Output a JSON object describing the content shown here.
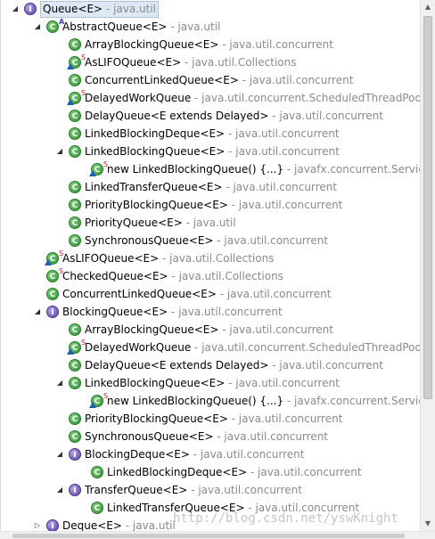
{
  "tree": [
    {
      "indent": 0,
      "twisty": "open",
      "icon": "iface",
      "overlay": "",
      "name": "Queue<E>",
      "pkg": " - java.util",
      "selected": true
    },
    {
      "indent": 1,
      "twisty": "open",
      "icon": "class",
      "overlay": "A",
      "name": "AbstractQueue<E>",
      "pkg": " - java.util"
    },
    {
      "indent": 2,
      "twisty": "",
      "icon": "class",
      "overlay": "",
      "name": "ArrayBlockingQueue<E>",
      "pkg": " - java.util.concurrent"
    },
    {
      "indent": 2,
      "twisty": "",
      "icon": "class",
      "overlay": "S",
      "tri": true,
      "name": "AsLIFOQueue<E>",
      "pkg": " - java.util.Collections"
    },
    {
      "indent": 2,
      "twisty": "",
      "icon": "class",
      "overlay": "",
      "name": "ConcurrentLinkedQueue<E>",
      "pkg": " - java.util.concurrent"
    },
    {
      "indent": 2,
      "twisty": "",
      "icon": "class",
      "overlay": "S",
      "tri": true,
      "name": "DelayedWorkQueue",
      "pkg": " - java.util.concurrent.ScheduledThreadPoo"
    },
    {
      "indent": 2,
      "twisty": "",
      "icon": "class",
      "overlay": "",
      "name": "DelayQueue<E extends Delayed>",
      "pkg": " - java.util.concurrent"
    },
    {
      "indent": 2,
      "twisty": "",
      "icon": "class",
      "overlay": "",
      "name": "LinkedBlockingDeque<E>",
      "pkg": " - java.util.concurrent"
    },
    {
      "indent": 2,
      "twisty": "open",
      "icon": "class",
      "overlay": "",
      "name": "LinkedBlockingQueue<E>",
      "pkg": " - java.util.concurrent"
    },
    {
      "indent": 3,
      "twisty": "",
      "icon": "class",
      "overlay": "S",
      "tri": true,
      "name": "new LinkedBlockingQueue() {...}",
      "pkg": " - javafx.concurrent.Service"
    },
    {
      "indent": 2,
      "twisty": "",
      "icon": "class",
      "overlay": "",
      "name": "LinkedTransferQueue<E>",
      "pkg": " - java.util.concurrent"
    },
    {
      "indent": 2,
      "twisty": "",
      "icon": "class",
      "overlay": "",
      "name": "PriorityBlockingQueue<E>",
      "pkg": " - java.util.concurrent"
    },
    {
      "indent": 2,
      "twisty": "",
      "icon": "class",
      "overlay": "",
      "name": "PriorityQueue<E>",
      "pkg": " - java.util"
    },
    {
      "indent": 2,
      "twisty": "",
      "icon": "class",
      "overlay": "",
      "name": "SynchronousQueue<E>",
      "pkg": " - java.util.concurrent"
    },
    {
      "indent": 1,
      "twisty": "",
      "icon": "class",
      "overlay": "S",
      "tri": true,
      "name": "AsLIFOQueue<E>",
      "pkg": " - java.util.Collections"
    },
    {
      "indent": 1,
      "twisty": "",
      "icon": "class",
      "overlay": "S",
      "name": "CheckedQueue<E>",
      "pkg": " - java.util.Collections"
    },
    {
      "indent": 1,
      "twisty": "",
      "icon": "class",
      "overlay": "",
      "name": "ConcurrentLinkedQueue<E>",
      "pkg": " - java.util.concurrent"
    },
    {
      "indent": 1,
      "twisty": "open",
      "icon": "iface",
      "overlay": "",
      "name": "BlockingQueue<E>",
      "pkg": " - java.util.concurrent"
    },
    {
      "indent": 2,
      "twisty": "",
      "icon": "class",
      "overlay": "",
      "name": "ArrayBlockingQueue<E>",
      "pkg": " - java.util.concurrent"
    },
    {
      "indent": 2,
      "twisty": "",
      "icon": "class",
      "overlay": "S",
      "tri": true,
      "name": "DelayedWorkQueue",
      "pkg": " - java.util.concurrent.ScheduledThreadPoo"
    },
    {
      "indent": 2,
      "twisty": "",
      "icon": "class",
      "overlay": "",
      "name": "DelayQueue<E extends Delayed>",
      "pkg": " - java.util.concurrent"
    },
    {
      "indent": 2,
      "twisty": "open",
      "icon": "class",
      "overlay": "",
      "name": "LinkedBlockingQueue<E>",
      "pkg": " - java.util.concurrent"
    },
    {
      "indent": 3,
      "twisty": "",
      "icon": "class",
      "overlay": "S",
      "tri": true,
      "name": "new LinkedBlockingQueue() {...}",
      "pkg": " - javafx.concurrent.Service"
    },
    {
      "indent": 2,
      "twisty": "",
      "icon": "class",
      "overlay": "",
      "name": "PriorityBlockingQueue<E>",
      "pkg": " - java.util.concurrent"
    },
    {
      "indent": 2,
      "twisty": "",
      "icon": "class",
      "overlay": "",
      "name": "SynchronousQueue<E>",
      "pkg": " - java.util.concurrent"
    },
    {
      "indent": 2,
      "twisty": "open",
      "icon": "iface",
      "overlay": "",
      "name": "BlockingDeque<E>",
      "pkg": " - java.util.concurrent"
    },
    {
      "indent": 3,
      "twisty": "",
      "icon": "class",
      "overlay": "",
      "name": "LinkedBlockingDeque<E>",
      "pkg": " - java.util.concurrent"
    },
    {
      "indent": 2,
      "twisty": "open",
      "icon": "iface",
      "overlay": "",
      "name": "TransferQueue<E>",
      "pkg": " - java.util.concurrent"
    },
    {
      "indent": 3,
      "twisty": "",
      "icon": "class",
      "overlay": "",
      "name": "LinkedTransferQueue<E>",
      "pkg": " - java.util.concurrent"
    },
    {
      "indent": 1,
      "twisty": "closed",
      "icon": "iface",
      "overlay": "",
      "name": "Deque<E>",
      "pkg": " - java.util"
    }
  ],
  "watermark": "http://blog.csdn.net/yswKnight",
  "icons": {
    "twisty_open": "chevron-down-icon",
    "twisty_closed": "chevron-right-icon",
    "class": "class-icon",
    "interface": "interface-icon"
  },
  "colors": {
    "class": "#2f8f2f",
    "interface": "#5a3fa8",
    "package": "#8a8a8a",
    "selection": "#dde8f6"
  }
}
